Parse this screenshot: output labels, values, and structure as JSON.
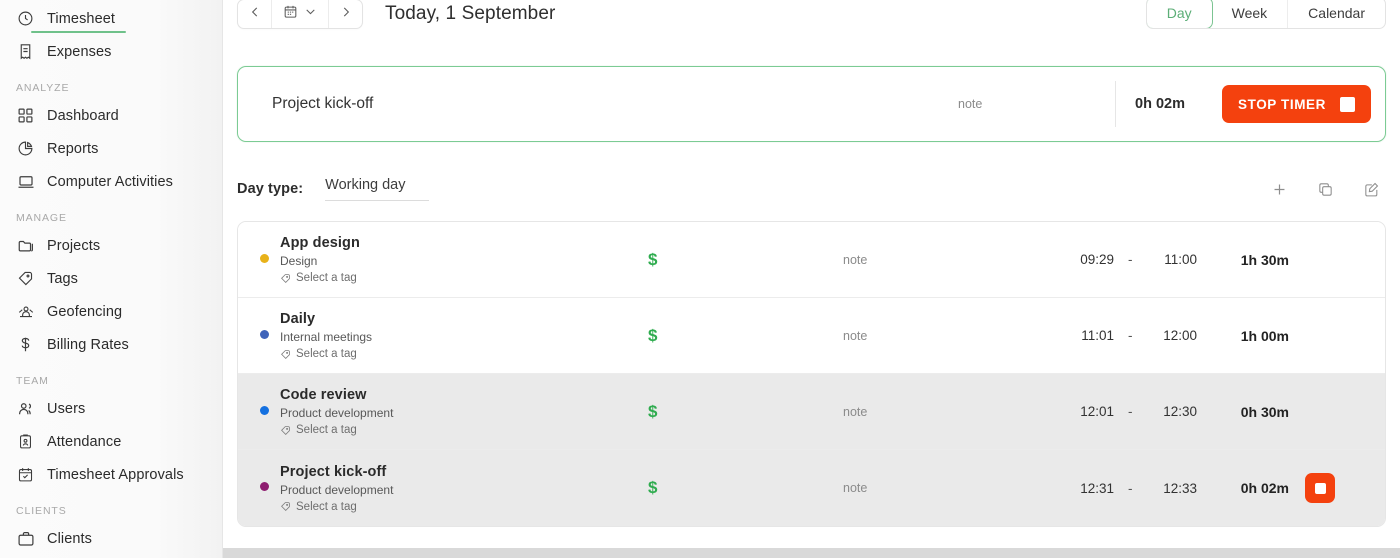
{
  "sidebar": {
    "items": [
      {
        "label": "Timesheet",
        "icon": "clock-icon",
        "active": true
      },
      {
        "label": "Expenses",
        "icon": "receipt-icon",
        "active": false
      }
    ],
    "sections": [
      {
        "title": "ANALYZE",
        "items": [
          {
            "label": "Dashboard",
            "icon": "grid-icon"
          },
          {
            "label": "Reports",
            "icon": "pie-chart-icon"
          },
          {
            "label": "Computer Activities",
            "icon": "laptop-icon"
          }
        ]
      },
      {
        "title": "MANAGE",
        "items": [
          {
            "label": "Projects",
            "icon": "folder-icon"
          },
          {
            "label": "Tags",
            "icon": "tag-icon"
          },
          {
            "label": "Geofencing",
            "icon": "geofence-icon"
          },
          {
            "label": "Billing Rates",
            "icon": "dollar-icon"
          }
        ]
      },
      {
        "title": "TEAM",
        "items": [
          {
            "label": "Users",
            "icon": "users-icon"
          },
          {
            "label": "Attendance",
            "icon": "clipboard-person-icon"
          },
          {
            "label": "Timesheet Approvals",
            "icon": "calendar-check-icon"
          }
        ]
      },
      {
        "title": "CLIENTS",
        "items": [
          {
            "label": "Clients",
            "icon": "briefcase-icon"
          }
        ]
      }
    ]
  },
  "header": {
    "prev_icon": "chevron-left-icon",
    "calendar_icon": "calendar-icon",
    "chevron_icon": "chevron-down-icon",
    "next_icon": "chevron-right-icon",
    "date_title": "Today, 1 September",
    "view_tabs": [
      {
        "label": "Day",
        "active": true
      },
      {
        "label": "Week",
        "active": false
      },
      {
        "label": "Calendar",
        "active": false
      }
    ],
    "active_tab_color": "#5cae77"
  },
  "running_timer": {
    "title": "Project kick-off",
    "note": "note",
    "duration": "0h 02m",
    "stop_label": "STOP TIMER",
    "stop_color": "#f4410e",
    "border_color": "#7ccb94"
  },
  "day_type": {
    "label": "Day type:",
    "value": "Working day",
    "actions": [
      {
        "name": "add-entry",
        "icon": "plus-icon"
      },
      {
        "name": "duplicate-entry",
        "icon": "copy-icon"
      },
      {
        "name": "edit-entry",
        "icon": "edit-icon"
      }
    ]
  },
  "entries": {
    "tag_placeholder": "Select a tag",
    "billable_symbol": "$",
    "billable_color": "#2fac4f",
    "dash": "-",
    "rows": [
      {
        "title": "App design",
        "project": "Design",
        "dot_color": "#e8b21a",
        "tag": "Select a tag",
        "note": "note",
        "start": "09:29",
        "end": "11:00",
        "duration": "1h 30m",
        "running": false,
        "highlight": false
      },
      {
        "title": "Daily",
        "project": "Internal meetings",
        "dot_color": "#4064ba",
        "tag": "Select a tag",
        "note": "note",
        "start": "11:01",
        "end": "12:00",
        "duration": "1h 00m",
        "running": false,
        "highlight": false
      },
      {
        "title": "Code review",
        "project": "Product development",
        "dot_color": "#1470e0",
        "tag": "Select a tag",
        "note": "note",
        "start": "12:01",
        "end": "12:30",
        "duration": "0h 30m",
        "running": false,
        "highlight": true
      },
      {
        "title": "Project kick-off",
        "project": "Product development",
        "dot_color": "#8e1d70",
        "tag": "Select a tag",
        "note": "note",
        "start": "12:31",
        "end": "12:33",
        "duration": "0h 02m",
        "running": true,
        "highlight": true
      }
    ]
  }
}
